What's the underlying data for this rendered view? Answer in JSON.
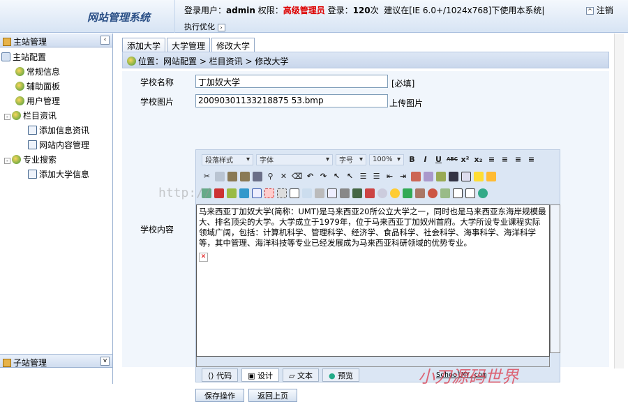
{
  "header": {
    "title": "网站管理系统",
    "user_label": "登录用户：",
    "user": "admin",
    "perm_label": "权限：",
    "role": "高级管理员",
    "login_label": "登录：",
    "login_count": "120",
    "login_unit": "次",
    "tip": "建议在[IE 6.0+/1024x768]下使用本系统|",
    "optimize": "执行优化",
    "logout": "注销"
  },
  "sidebar": {
    "title": "主站管理",
    "items": [
      {
        "label": "主站配置"
      },
      {
        "label": "常规信息"
      },
      {
        "label": "辅助面板"
      },
      {
        "label": "用户管理"
      },
      {
        "label": "栏目资讯"
      },
      {
        "label": "添加信息资讯"
      },
      {
        "label": "网站内容管理"
      },
      {
        "label": "专业搜索"
      },
      {
        "label": "添加大学信息"
      }
    ],
    "bottom": "子站管理"
  },
  "tabs": [
    "添加大学",
    "大学管理",
    "修改大学"
  ],
  "breadcrumb": "位置：网站配置 > 栏目资讯 > 修改大学",
  "form": {
    "name_label": "学校名称",
    "name_value": "丁加奴大学",
    "required": "[必填]",
    "image_label": "学校图片",
    "image_value": "20090301133218875 53.bmp",
    "upload": "上传图片",
    "content_label": "学校内容"
  },
  "editor": {
    "para_style": "段落样式",
    "font": "字体",
    "size": "字号",
    "zoom": "100%",
    "content": "马来西亚丁加奴大学(简称：UMT)是马来西亚20所公立大学之一，同时也是马来西亚东海岸规模最大、排名顶尖的大学。大学成立于1979年，位于马来西亚丁加奴州首府。大学所设专业课程实际领域广阔，包括：计算机科学、管理科学、经济学、食品科学、社会科学、海事科学、海洋科学等，其中管理、海洋科技等专业已经发展成为马来西亚科研领域的优势专业。",
    "modes": [
      "代码",
      "设计",
      "文本",
      "预览"
    ]
  },
  "buttons": {
    "save": "保存操作",
    "back": "返回上页"
  },
  "watermarks": {
    "brand": "小刀源码世界",
    "site": "SchoolMY.com",
    "url": "http://"
  }
}
